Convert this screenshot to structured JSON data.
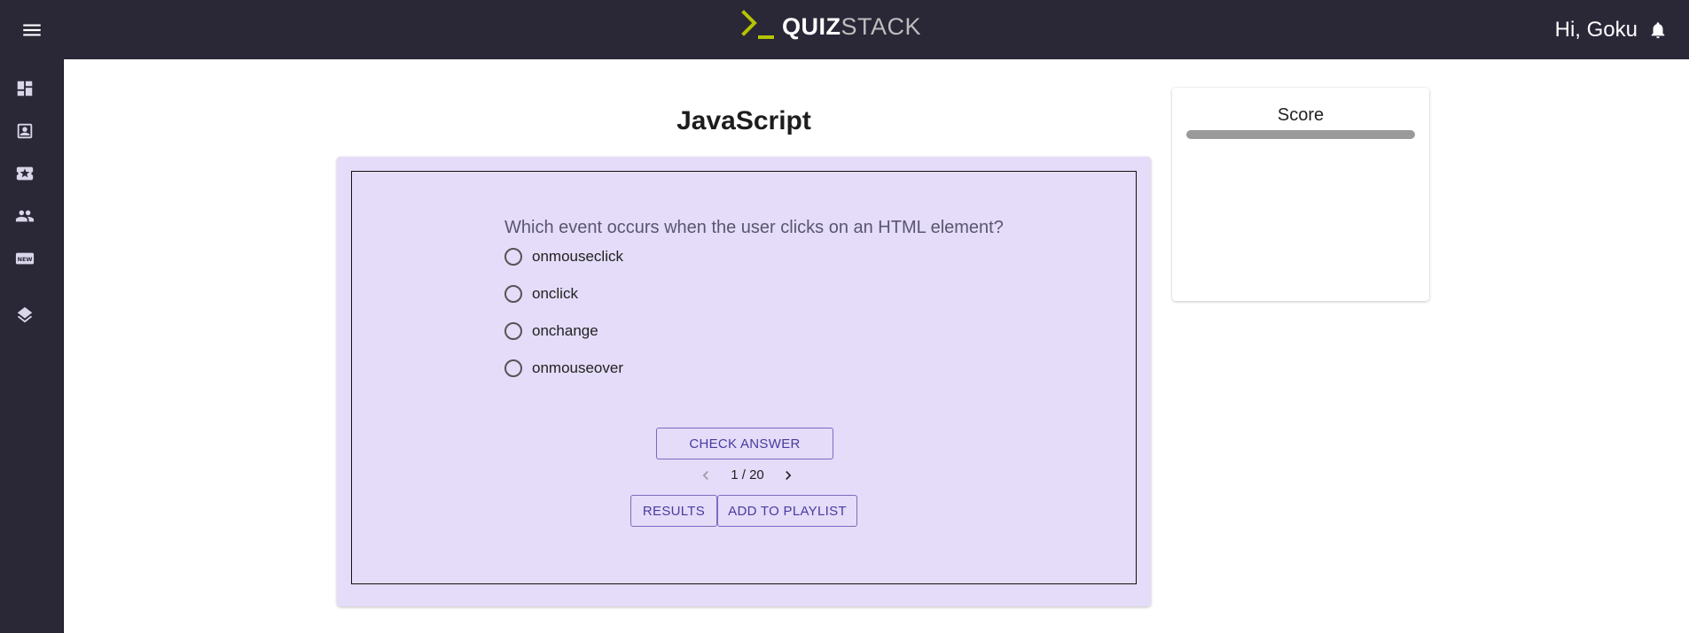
{
  "header": {
    "logo_bold": "QUIZ",
    "logo_light": "STACK",
    "greeting": "Hi, Goku"
  },
  "sidebar": {
    "items": [
      {
        "icon": "dashboard-icon"
      },
      {
        "icon": "profile-card-icon"
      },
      {
        "icon": "star-ticket-icon"
      },
      {
        "icon": "people-icon"
      },
      {
        "icon": "new-badge-icon"
      },
      {
        "icon": "layers-icon"
      }
    ]
  },
  "quiz": {
    "title": "JavaScript",
    "question": "Which event occurs when the user clicks on an HTML element?",
    "options": [
      "onmouseclick",
      "onclick",
      "onchange",
      "onmouseover"
    ],
    "check_answer_label": "CHECK ANSWER",
    "pager": {
      "current": 1,
      "total": 20,
      "text": "1 / 20"
    },
    "results_label": "RESULTS",
    "add_to_playlist_label": "ADD TO PLAYLIST"
  },
  "score": {
    "title": "Score",
    "progress": 0
  },
  "colors": {
    "topbar": "#2a2737",
    "accent": "#7b6cc0",
    "card_bg": "#e4dcf8",
    "logo_green": "#b5c400"
  }
}
